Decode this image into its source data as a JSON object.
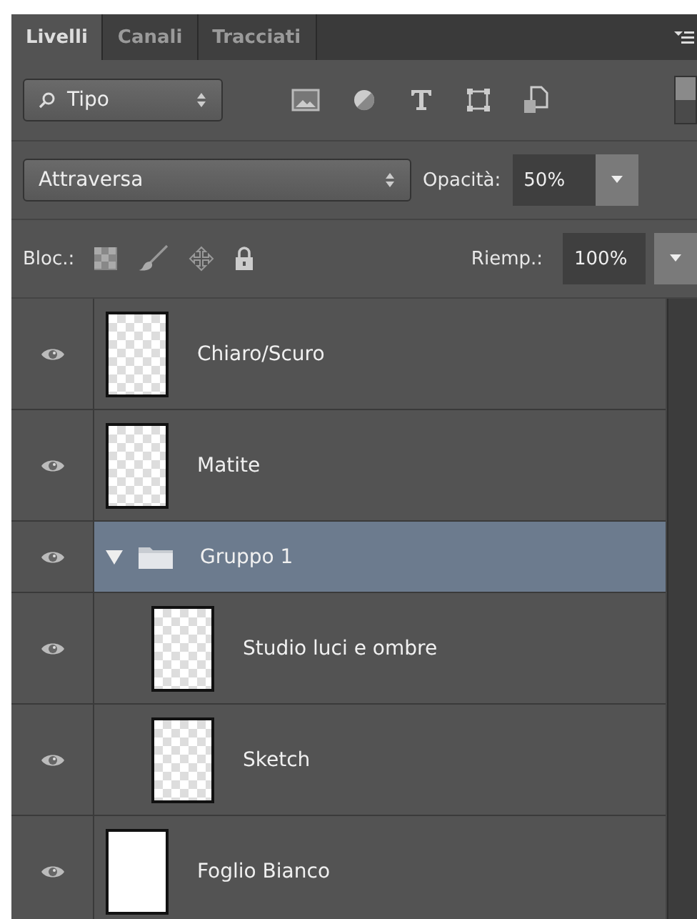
{
  "tabs": [
    {
      "label": "Livelli",
      "selected": true
    },
    {
      "label": "Canali",
      "selected": false
    },
    {
      "label": "Tracciati",
      "selected": false
    }
  ],
  "filter": {
    "value": "Tipo"
  },
  "blend_mode": {
    "value": "Attraversa"
  },
  "opacity": {
    "label": "Opacità:",
    "value": "50%"
  },
  "lock": {
    "label": "Bloc.:"
  },
  "fill": {
    "label": "Riemp.:",
    "value": "100%"
  },
  "layers": [
    {
      "kind": "layer",
      "name": "Chiaro/Scuro",
      "visible": true,
      "selected": false,
      "transparent": true
    },
    {
      "kind": "layer",
      "name": "Matite",
      "visible": true,
      "selected": false,
      "transparent": true
    },
    {
      "kind": "group",
      "name": "Gruppo 1",
      "visible": true,
      "selected": true,
      "expanded": true,
      "children": [
        {
          "kind": "layer",
          "name": "Studio luci e ombre",
          "visible": true,
          "selected": false,
          "transparent": true
        },
        {
          "kind": "layer",
          "name": "Sketch",
          "visible": true,
          "selected": false,
          "transparent": true
        }
      ]
    },
    {
      "kind": "layer",
      "name": "Foglio Bianco",
      "visible": true,
      "selected": false,
      "transparent": false
    }
  ]
}
